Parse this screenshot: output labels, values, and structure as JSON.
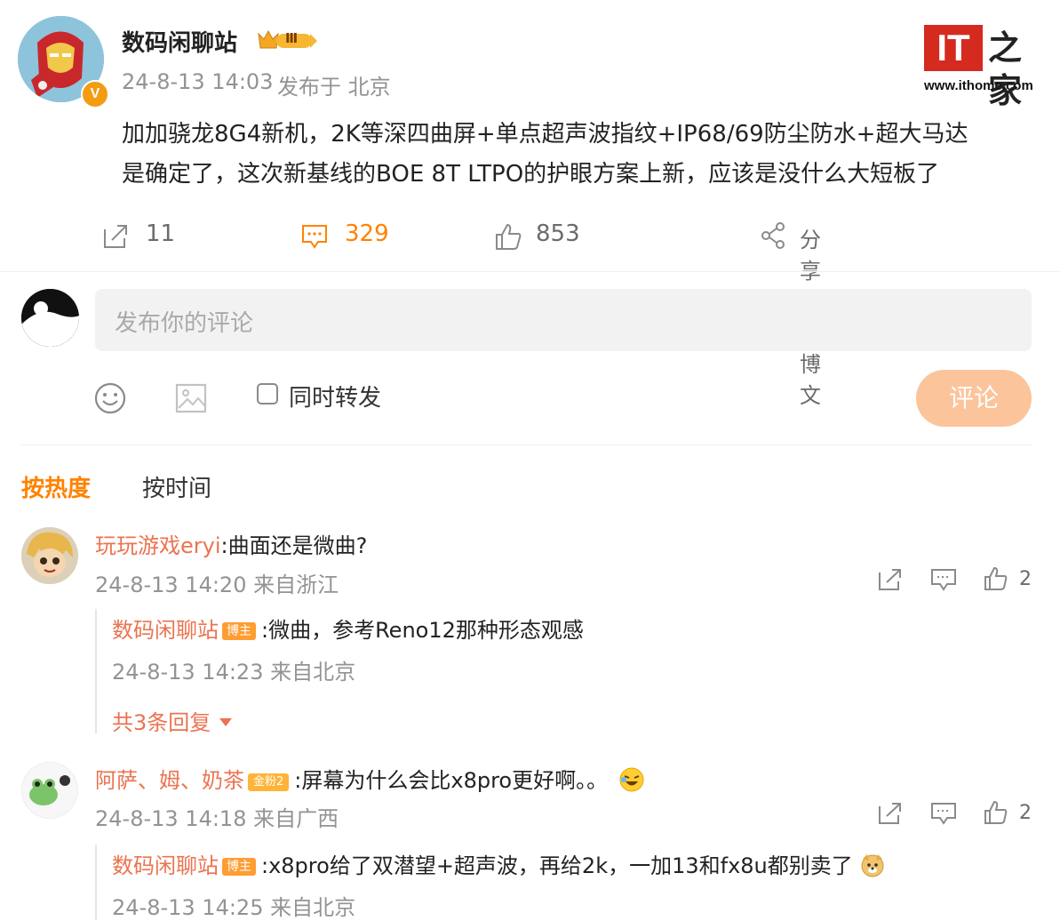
{
  "post": {
    "author": "数码闲聊站",
    "level_badge": "Ⅲ",
    "verified_mark": "V",
    "time": "24-8-13 14:03",
    "location": "发布于 北京",
    "text_line1": "加加骁龙8G4新机，2K等深四曲屏+单点超声波指纹+IP68/69防尘防水+超大马达",
    "text_line2": "是确定了，这次新基线的BOE 8T LTPO的护眼方案上新，应该是没什么大短板了",
    "repost_count": "11",
    "comment_count": "329",
    "like_count": "853",
    "share_label": "分享这条博文"
  },
  "watermark": {
    "logo": "IT",
    "logo_cn": "之家",
    "url": "www.ithome.com"
  },
  "composer": {
    "placeholder": "发布你的评论",
    "repost_label": "同时转发",
    "submit_label": "评论"
  },
  "sort": {
    "hot": "按热度",
    "time": "按时间"
  },
  "comments": [
    {
      "user": "玩玩游戏eryi",
      "text": ":曲面还是微曲?",
      "time": "24-8-13 14:20 来自浙江",
      "likes": "2",
      "reply": {
        "user": "数码闲聊站",
        "badge": "博主",
        "text": ":微曲，参考Reno12那种形态观感",
        "time": "24-8-13 14:23 来自北京",
        "more": "共3条回复"
      }
    },
    {
      "user": "阿萨、姆、奶茶",
      "badge": "金粉2",
      "text": ":屏幕为什么会比x8pro更好啊。。",
      "time": "24-8-13 14:18 来自广西",
      "likes": "2",
      "reply": {
        "user": "数码闲聊站",
        "badge": "博主",
        "text": ":x8pro给了双潜望+超声波，再给2k，一加13和fx8u都别卖了",
        "time": "24-8-13 14:25 来自北京"
      }
    }
  ],
  "colors": {
    "accent": "#eb7350",
    "submit_bg": "#fbc49b",
    "input_bg": "#f2f2f2"
  }
}
